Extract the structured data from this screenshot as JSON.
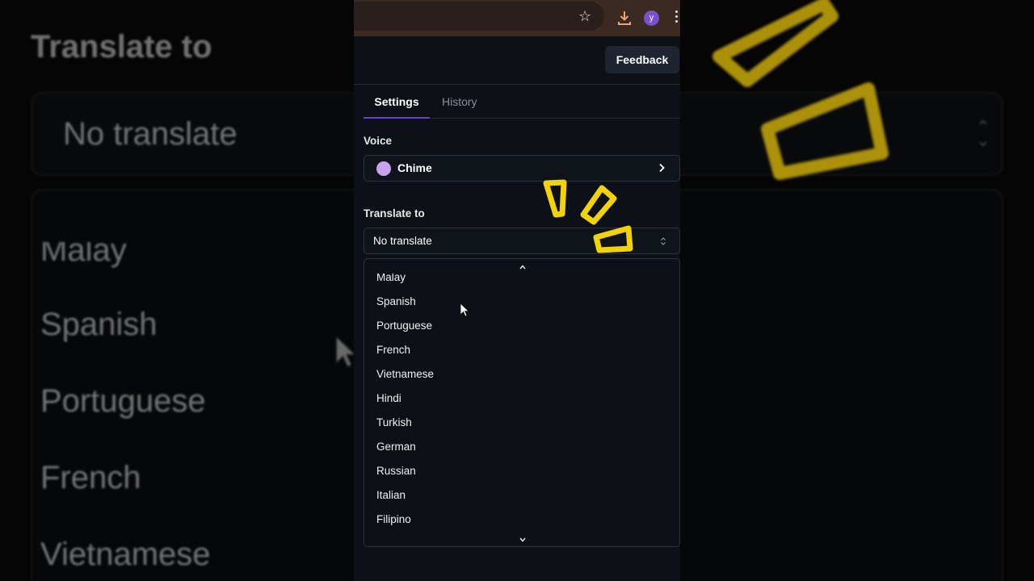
{
  "browser": {
    "avatar_letter": "y",
    "icons": [
      "star-icon",
      "download-icon",
      "kebab-menu-icon"
    ]
  },
  "header": {
    "feedback_label": "Feedback"
  },
  "tabs": [
    {
      "label": "Settings",
      "active": true
    },
    {
      "label": "History",
      "active": false
    }
  ],
  "voice": {
    "label": "Voice",
    "selected": "Chime",
    "swatch_color": "#c7a3ea"
  },
  "translate": {
    "label": "Translate to",
    "selected": "No translate",
    "options": [
      "Malay",
      "Spanish",
      "Portuguese",
      "French",
      "Vietnamese",
      "Hindi",
      "Turkish",
      "German",
      "Russian",
      "Italian",
      "Filipino"
    ]
  },
  "backdrop": {
    "title": "Translate to",
    "select_value": "No translate",
    "options": [
      "Malay",
      "Spanish",
      "Portuguese",
      "French",
      "Vietnamese"
    ]
  },
  "colors": {
    "accent": "#6d3fd1",
    "panel_bg": "#0d1117",
    "highlighter": "#f2d20a"
  }
}
